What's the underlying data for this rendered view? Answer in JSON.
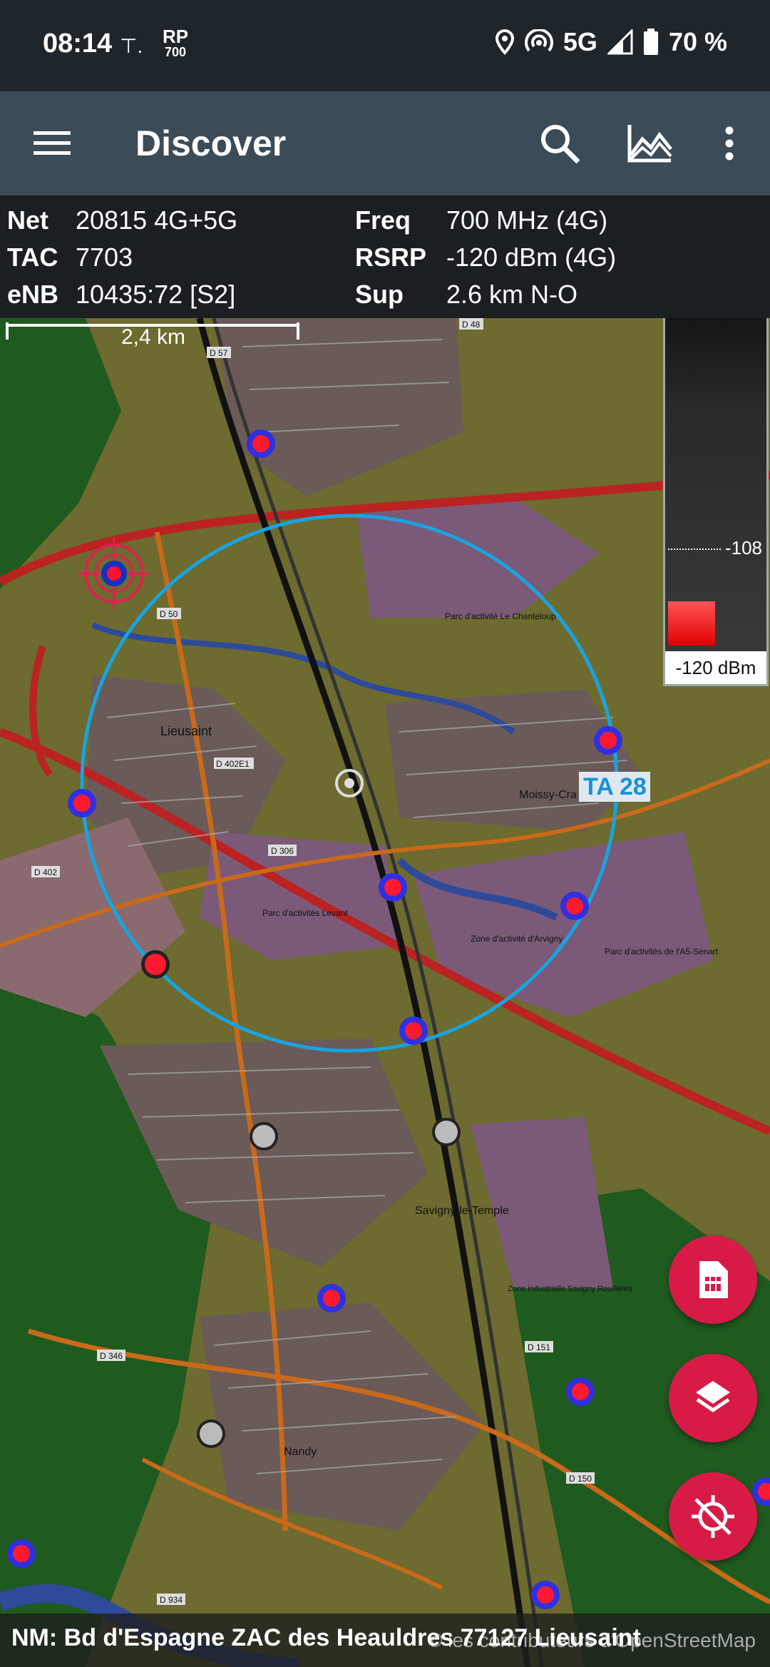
{
  "status_bar": {
    "time": "08:14",
    "rp_top": "RP",
    "rp_bottom": "700",
    "network": "5G",
    "battery": "70 %"
  },
  "app_bar": {
    "title": "Discover",
    "icons": [
      "menu-icon",
      "search-icon",
      "chart-icon",
      "more-vertical-icon"
    ]
  },
  "cell_info": {
    "net_label": "Net",
    "net_value": "20815  4G+5G",
    "tac_label": "TAC",
    "tac_value": "7703",
    "enb_label": "eNB",
    "enb_value": "10435:72  [S2]",
    "freq_label": "Freq",
    "freq_value": "700 MHz  (4G)",
    "rsrp_label": "RSRP",
    "rsrp_value": "-120 dBm  (4G)",
    "sup_label": "Sup",
    "sup_value": "2.6 km N-O"
  },
  "map": {
    "scale_label": "2,4 km",
    "ta_label": "TA 28",
    "signal_legend": {
      "marker": "-108",
      "value": "-120 dBm"
    },
    "place_labels": {
      "lieusaint": "Lieusaint",
      "moissy": "Moissy-Cra",
      "savigny": "Savigny-le-Temple",
      "nandy": "Nandy",
      "parc_chanteloup": "Parc d'activité Le Chanteloup",
      "parc_levant": "Parc d'activités Levant",
      "zone_arvigny": "Zone d'activité d'Arvigny",
      "parc_senart": "Parc d'activités de l'A5-Sénart",
      "zone_savigny": "Zone industrielle Savigny Rouillères"
    },
    "road_labels": [
      "D 50",
      "D 57",
      "D 306",
      "D 402",
      "D 402E1",
      "D 151",
      "D 346",
      "D 150",
      "D 934",
      "D 48"
    ]
  },
  "fabs": [
    "sim-card-icon",
    "layers-icon",
    "gps-off-icon"
  ],
  "bottom_bar": {
    "address": "NM: Bd  d'Espagne ZAC des Heauldres 77127 Lieusaint",
    "attribution": "© les contributeurs d'OpenStreetMap"
  },
  "colors": {
    "accent": "#d81b46",
    "ta_circle": "#1aa3e0",
    "app_bar": "#3b4b57"
  }
}
